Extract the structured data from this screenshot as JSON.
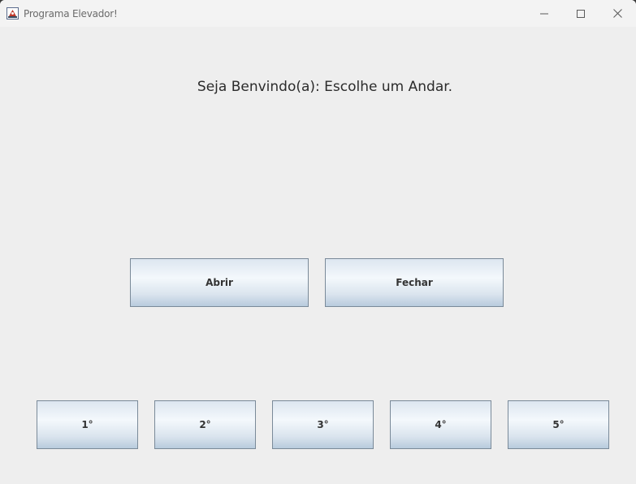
{
  "window": {
    "title": "Programa Elevador!",
    "icon": "java-app-icon",
    "controls": {
      "minimize_icon": "minimize-icon",
      "maximize_icon": "maximize-icon",
      "close_icon": "close-icon"
    }
  },
  "main": {
    "welcome_text": "Seja Benvindo(a): Escolhe um Andar.",
    "door_buttons": {
      "open_label": "Abrir",
      "close_label": "Fechar"
    },
    "floors": [
      "1°",
      "2°",
      "3°",
      "4°",
      "5°"
    ]
  },
  "colors": {
    "background": "#eeeeee",
    "titlebar": "#f3f3f3",
    "button_border": "#7a8a99",
    "button_gradient_top": "#dce6f0",
    "button_gradient_bottom": "#b8cbdd"
  }
}
